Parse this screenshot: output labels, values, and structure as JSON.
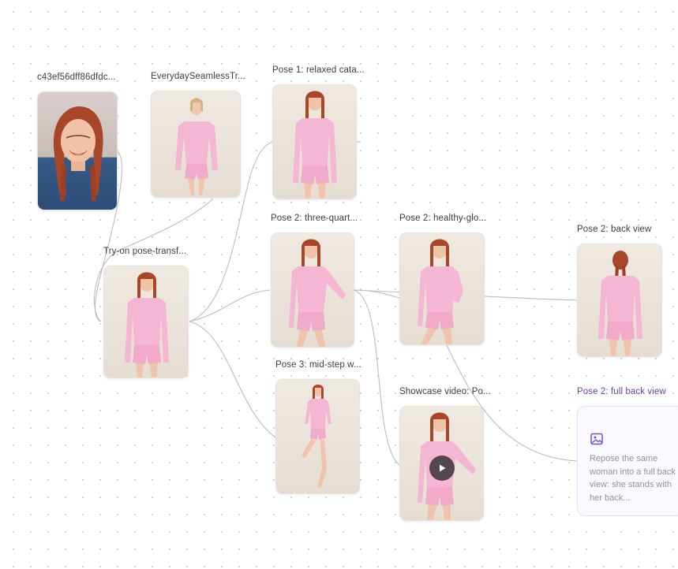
{
  "nodes": {
    "source_portrait": {
      "label": "c43ef56dff86dfdc..."
    },
    "garment": {
      "label": "EverydaySeamlessTr..."
    },
    "tryon": {
      "label": "Try-on pose-transf..."
    },
    "pose1_relaxed": {
      "label": "Pose 1: relaxed cata..."
    },
    "pose2_three_quarter": {
      "label": "Pose 2: three-quart..."
    },
    "pose3_mid_step": {
      "label": "Pose 3: mid-step w..."
    },
    "pose2_healthy_glow": {
      "label": "Pose 2: healthy-glo..."
    },
    "showcase_video": {
      "label": "Showcase video: Po..."
    },
    "pose2_back_view": {
      "label": "Pose 2: back view"
    },
    "pose2_full_back_view": {
      "label": "Pose 2: full back view",
      "prompt": "Repose the same woman into a full back view: she stands with her back..."
    }
  },
  "icons": {
    "play": "play-icon",
    "image_prompt": "image-icon"
  },
  "colors": {
    "accent": "#6a3fb0",
    "edge": "#b9bcc3",
    "garment_pink": "#f4b6d2",
    "hair": "#a8462a"
  }
}
